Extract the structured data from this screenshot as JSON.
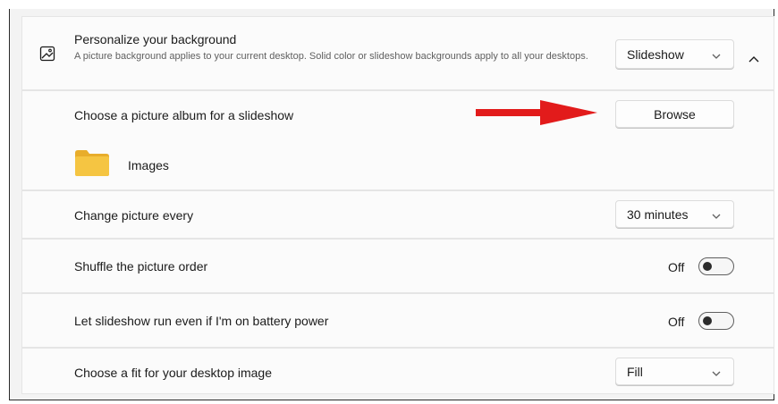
{
  "header": {
    "title": "Personalize your background",
    "description": "A picture background applies to your current desktop. Solid color or slideshow backgrounds apply to all your desktops.",
    "dropdown_value": "Slideshow",
    "icon": "image-icon",
    "collapse_icon": "chevron-up-icon"
  },
  "album": {
    "label": "Choose a picture album for a slideshow",
    "button_label": "Browse",
    "folder_name": "Images",
    "folder_icon": "folder-icon",
    "annotation": "red-arrow"
  },
  "interval": {
    "label": "Change picture every",
    "value": "30 minutes"
  },
  "shuffle": {
    "label": "Shuffle the picture order",
    "state_text": "Off"
  },
  "battery": {
    "label": "Let slideshow run even if I'm on battery power",
    "state_text": "Off"
  },
  "fit": {
    "label": "Choose a fit for your desktop image",
    "value": "Fill"
  },
  "colors": {
    "annotation_arrow": "#e21b1b",
    "folder": "#f5c542",
    "card": "#fbfbfb",
    "page": "#f3f3f3"
  }
}
